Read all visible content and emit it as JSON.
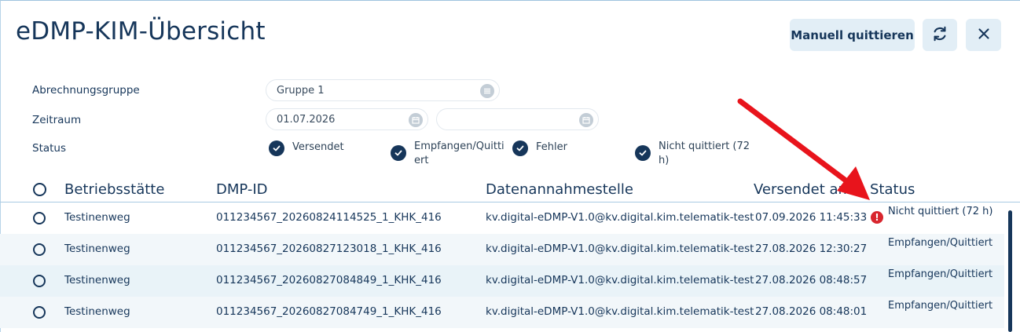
{
  "header": {
    "title": "eDMP-KIM-Übersicht",
    "manual_ack_label": "Manuell quittieren"
  },
  "filters": {
    "group_label": "Abrechnungsgruppe",
    "group_value": "Gruppe 1",
    "period_label": "Zeitraum",
    "period_from": "01.07.2026",
    "period_to": "",
    "status_label": "Status",
    "status_options": [
      {
        "label": "Versendet",
        "checked": true
      },
      {
        "label": "Empfangen/Quitti ert",
        "checked": true
      },
      {
        "label": "Fehler",
        "checked": true
      },
      {
        "label": "Nicht quittiert (72 h)",
        "checked": true
      }
    ]
  },
  "table": {
    "columns": [
      "Betriebsstätte",
      "DMP-ID",
      "Datenannahmestelle",
      "Versendet am",
      "Status"
    ],
    "rows": [
      {
        "site": "Testinenweg",
        "dmp_id": "011234567_20260824114525_1_KHK_416",
        "recipient": "kv.digital-eDMP-V1.0@kv.digital.kim.telematik-test",
        "sent": "07.09.2026 11:45:33",
        "status": "Nicht quittiert (72 h)",
        "error": true
      },
      {
        "site": "Testinenweg",
        "dmp_id": "011234567_20260827123018_1_KHK_416",
        "recipient": "kv.digital-eDMP-V1.0@kv.digital.kim.telematik-test",
        "sent": "27.08.2026 12:30:27",
        "status": "Empfangen/Quittiert",
        "error": false
      },
      {
        "site": "Testinenweg",
        "dmp_id": "011234567_20260827084849_1_KHK_416",
        "recipient": "kv.digital-eDMP-V1.0@kv.digital.kim.telematik-test",
        "sent": "27.08.2026 08:48:57",
        "status": "Empfangen/Quittiert",
        "error": false
      },
      {
        "site": "Testinenweg",
        "dmp_id": "011234567_20260827084749_1_KHK_416",
        "recipient": "kv.digital-eDMP-V1.0@kv.digital.kim.telematik-test",
        "sent": "27.08.2026 08:48:01",
        "status": "Empfangen/Quittiert",
        "error": false
      }
    ]
  },
  "icons": {
    "refresh": "refresh-icon",
    "close": "close-icon",
    "list": "list-icon",
    "calendar": "calendar-icon",
    "check": "check-icon",
    "error": "error-icon"
  },
  "colors": {
    "primary": "#16365a",
    "button_bg": "#e2eef6",
    "error": "#d8262e",
    "annotation_arrow": "#e8141c"
  }
}
